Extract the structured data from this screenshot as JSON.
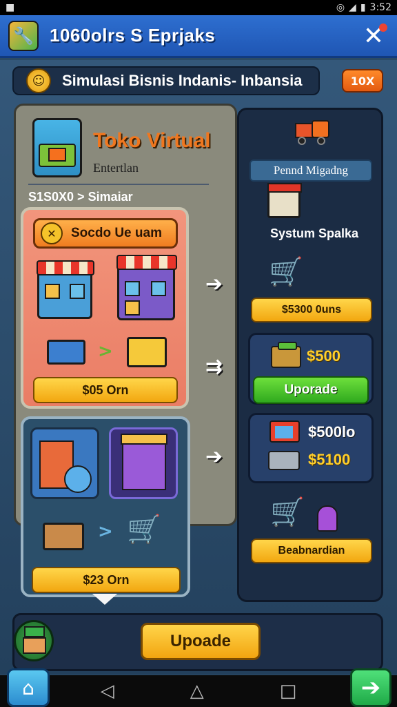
{
  "status_bar": {
    "time": "3:52",
    "left_icon": "notification-icon"
  },
  "header": {
    "title": "1060olrs   S Eprjaks",
    "close_icon": "close-icon"
  },
  "banner": {
    "text": "Simulasi Bisnis Indanis- Inbansia",
    "level": "10X"
  },
  "shop": {
    "title": "Toko Virtual",
    "subtitle": "Entertlan",
    "breadcrumb": "S1S0X0 > Simaiar"
  },
  "card_a": {
    "title": "Socdo Ue uam",
    "price": "$05 Orn"
  },
  "card_b": {
    "price": "$23 Orn"
  },
  "right_panel": {
    "header": "Pennd Migadng",
    "store_label": "Systum Spalka",
    "price_1": "$5300 0uns",
    "card_1_amount": "$500",
    "card_1_button": "Uporade",
    "card_2_amount_1": "$500lo",
    "card_2_amount_2": "$5100",
    "footer_button": "Beabnardian"
  },
  "action_bar": {
    "upgrade_label": "Upoade"
  },
  "nav": {
    "back": "◁",
    "home": "△",
    "recent": "□"
  },
  "colors": {
    "title_bar": "#1f56b4",
    "accent_orange": "#f0771f",
    "button_yellow": "#f2a710",
    "button_green": "#2fa91e"
  }
}
